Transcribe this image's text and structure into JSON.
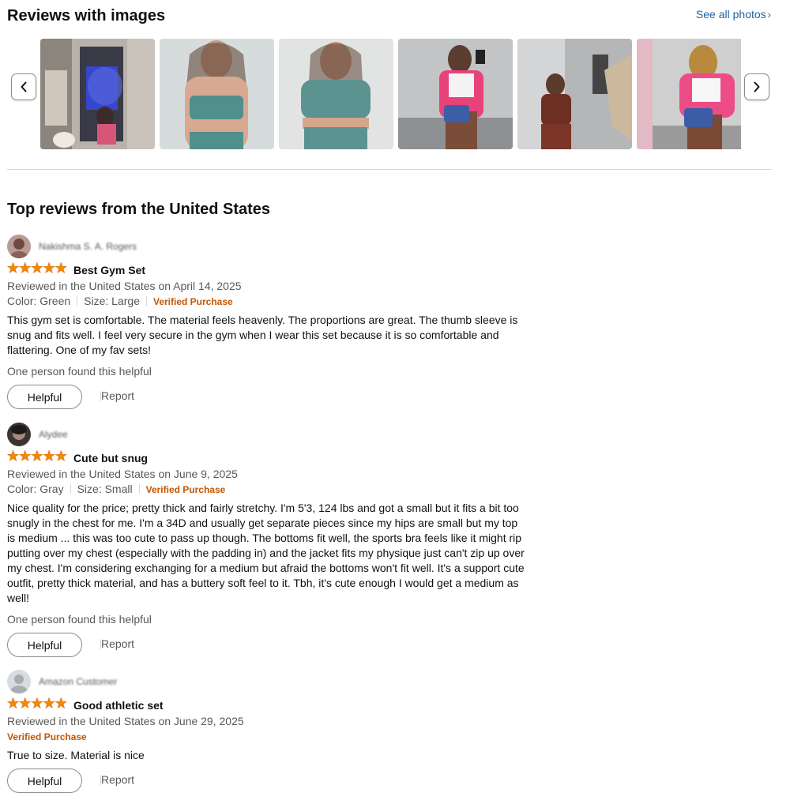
{
  "gallery": {
    "title": "Reviews with images",
    "see_all": "See all photos",
    "prev_icon": "chevron-left-icon",
    "next_icon": "chevron-right-icon"
  },
  "top_reviews": {
    "title": "Top reviews from the United States"
  },
  "colors": {
    "star": "#f08804",
    "verified": "#c45500",
    "link": "#2162a1",
    "muted": "#565959"
  },
  "reviews": [
    {
      "name": "Nakishma S. A. Rogers",
      "rating": 5,
      "title": "Best Gym Set",
      "date": "Reviewed in the United States on April 14, 2025",
      "color": "Color: Green",
      "size": "Size: Large",
      "verified": "Verified Purchase",
      "body": "This gym set is comfortable. The material feels heavenly. The proportions are great. The thumb sleeve is snug and fits well. I feel very secure in the gym when I wear this set because it is so comfortable and flattering. One of my fav sets!",
      "helpful_text": "One person found this helpful",
      "helpful_label": "Helpful",
      "report_label": "Report"
    },
    {
      "name": "Alydee",
      "rating": 5,
      "title": "Cute but snug",
      "date": "Reviewed in the United States on June 9, 2025",
      "color": "Color: Gray",
      "size": "Size: Small",
      "verified": "Verified Purchase",
      "body": "Nice quality for the price; pretty thick and fairly stretchy. I'm 5'3, 124 lbs and got a small but it fits a bit too snugly in the chest for me. I'm a 34D and usually get separate pieces since my hips are small but my top is medium ... this was too cute to pass up though. The bottoms fit well, the sports bra feels like it might rip putting over my chest (especially with the padding in) and the jacket fits my physique just can't zip up over my chest. I'm considering exchanging for a medium but afraid the bottoms won't fit well. It's a support cute outfit, pretty thick material, and has a buttery soft feel to it. Tbh, it's cute enough I would get a medium as well!",
      "helpful_text": "One person found this helpful",
      "helpful_label": "Helpful",
      "report_label": "Report"
    },
    {
      "name": "Amazon Customer",
      "rating": 5,
      "title": "Good athletic set",
      "date": "Reviewed in the United States on June 29, 2025",
      "verified": "Verified Purchase",
      "body": "True to size. Material is nice",
      "helpful_label": "Helpful",
      "report_label": "Report"
    }
  ]
}
